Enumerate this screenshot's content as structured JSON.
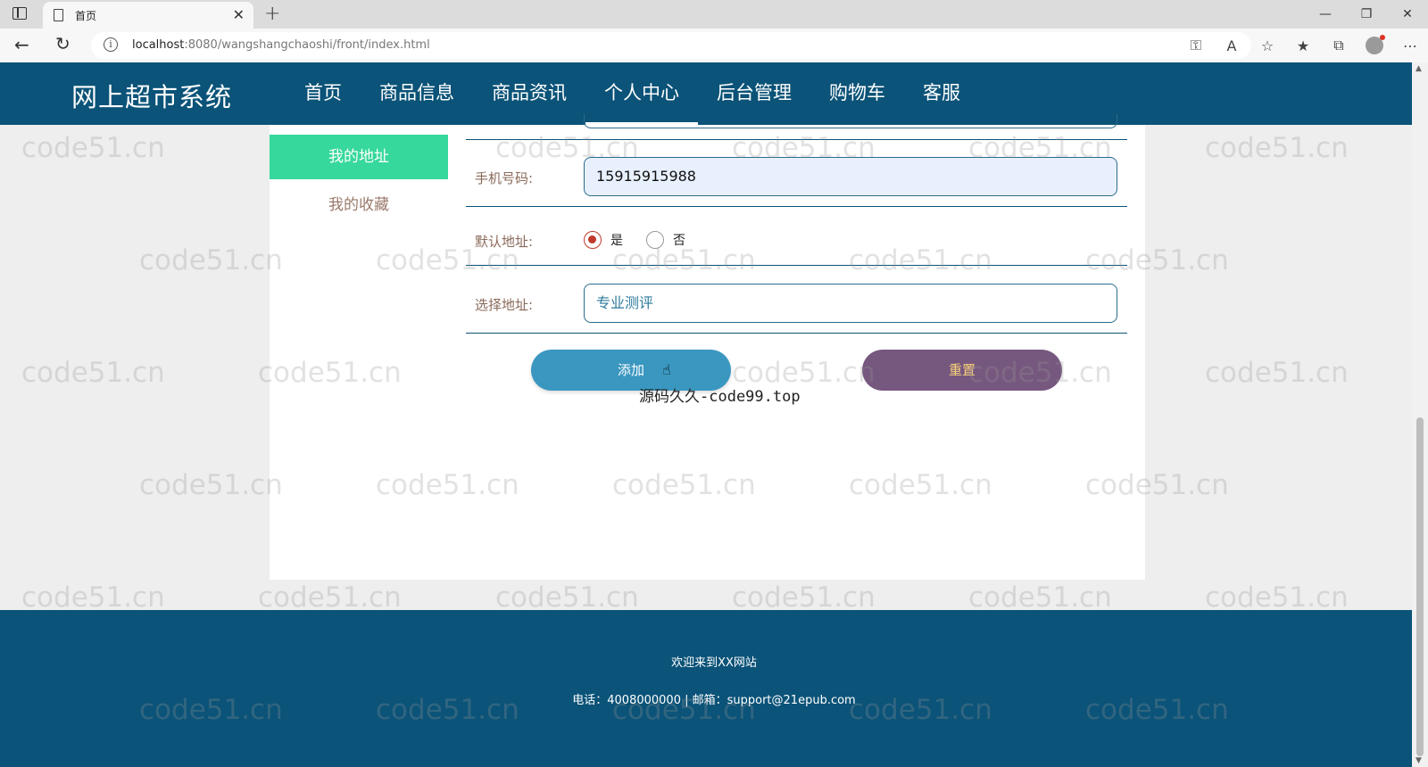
{
  "browser": {
    "tab_title": "首页",
    "url_host": "localhost",
    "url_rest": ":8080/wangshangchaoshi/front/index.html"
  },
  "site": {
    "logo": "网上超市系统",
    "nav": [
      "首页",
      "商品信息",
      "商品资讯",
      "个人中心",
      "后台管理",
      "购物车",
      "客服"
    ],
    "active_nav": "个人中心"
  },
  "sidebar": {
    "items": [
      {
        "label": "我的地址",
        "active": true
      },
      {
        "label": "我的收藏",
        "active": false
      }
    ]
  },
  "form": {
    "phone": {
      "label": "手机号码:",
      "value": "15915915988"
    },
    "default_address": {
      "label": "默认地址:",
      "options": [
        "是",
        "否"
      ],
      "selected": "是"
    },
    "address": {
      "label": "选择地址:",
      "value": "专业测评"
    },
    "add_button": "添加",
    "reset_button": "重置"
  },
  "caption": "源码久久-code99.top",
  "watermark": "code51.cn",
  "footer": {
    "welcome": "欢迎来到XX网站",
    "contact": "电话：4008000000 | 邮箱：support@21epub.com"
  },
  "colors": {
    "header_bg": "#0b5378",
    "sidebar_active": "#36d89b",
    "add_button": "#3a97c0",
    "reset_button": "#76587f"
  }
}
